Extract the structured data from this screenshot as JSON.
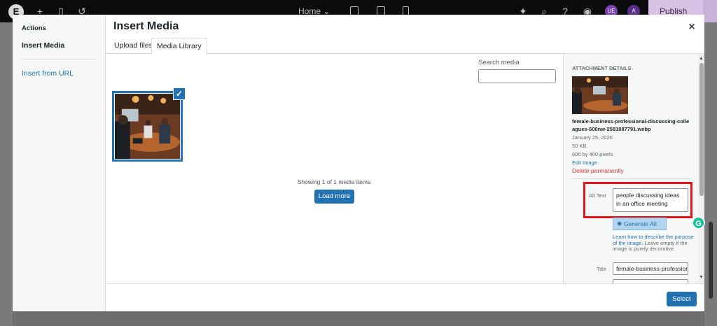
{
  "editor": {
    "logo": "E",
    "page_select": "Home ⌄",
    "publish_label": "Publish",
    "avatar_1": "UE",
    "avatar_2": "A"
  },
  "modal": {
    "title": "Insert Media",
    "close_icon": "×"
  },
  "menu": {
    "heading": "Actions",
    "items": [
      {
        "label": "Insert Media",
        "active": true
      },
      {
        "label": "Insert from URL",
        "active": false
      }
    ]
  },
  "tabs": [
    {
      "label": "Upload files",
      "active": false
    },
    {
      "label": "Media Library",
      "active": true
    }
  ],
  "browser": {
    "search_label": "Search media",
    "search_value": "",
    "checkmark": "✓",
    "showing_text": "Showing 1 of 1 media items",
    "load_more_label": "Load more"
  },
  "attachment": {
    "heading": "Attachment Details",
    "filename": "female-business-professional-discussing-colleagues-600nw-2581087791.webp",
    "date": "January 25, 2026",
    "file_size": "50 KB",
    "dimensions": "600 by 400 pixels",
    "edit_label": "Edit Image",
    "delete_label": "Delete permanently",
    "alt_label": "Alt Text",
    "alt_value": "people discussing ideas in an office meeting",
    "generate_alt_label": "Generate Alt",
    "learn_link": "Learn how to describe the purpose of the image.",
    "learn_rest": " Leave empty if the image is purely decorative.",
    "title_label": "Title",
    "title_value": "female-business-professional-discussing"
  },
  "footer": {
    "select_label": "Select"
  },
  "grammarly_letter": "G",
  "colors": {
    "accent": "#2271b1",
    "delete": "#d63638",
    "highlight": "#e3141c"
  }
}
